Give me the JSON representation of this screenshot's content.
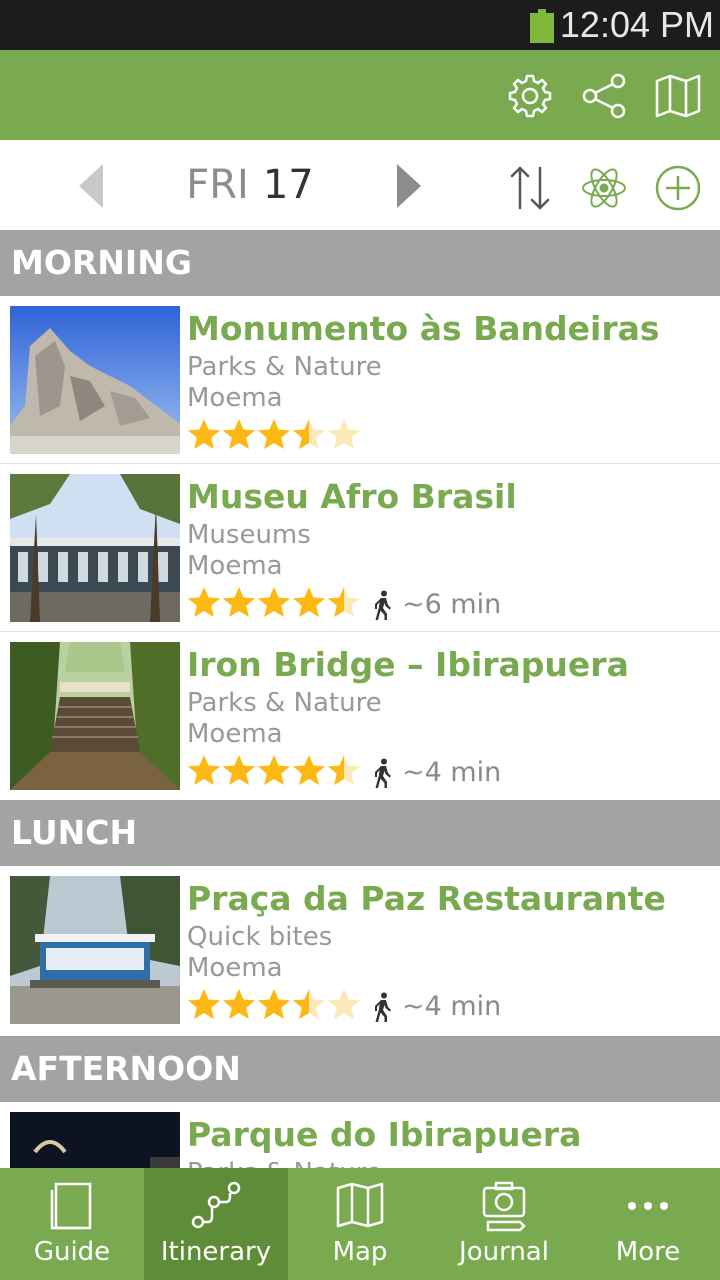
{
  "status_bar": {
    "time": "12:04 PM",
    "battery_icon": "battery-icon"
  },
  "app_bar": {
    "icons": [
      "settings-gear-icon",
      "share-icon",
      "map-icon"
    ]
  },
  "day_selector": {
    "day_of_week": "FRI",
    "day_number": "17"
  },
  "toolbar_icons": [
    "sort-icon",
    "atom-icon",
    "add-circle-icon"
  ],
  "sections": [
    {
      "label": "MORNING"
    },
    {
      "label": "LUNCH"
    },
    {
      "label": "AFTERNOON"
    }
  ],
  "items": [
    {
      "title": "Monumento às Bandeiras",
      "category": "Parks & Nature",
      "area": "Moema",
      "rating": 3.5,
      "walk": ""
    },
    {
      "title": "Museu Afro Brasil",
      "category": "Museums",
      "area": "Moema",
      "rating": 4.5,
      "walk": "~6 min"
    },
    {
      "title": "Iron Bridge – Ibirapuera",
      "category": "Parks & Nature",
      "area": "Moema",
      "rating": 4.5,
      "walk": "~4 min"
    },
    {
      "title": "Praça da Paz Restaurante",
      "category": "Quick bites",
      "area": "Moema",
      "rating": 3.5,
      "walk": "~4 min"
    },
    {
      "title": "Parque do Ibirapuera",
      "category": "Parks & Nature",
      "area": "",
      "rating": null,
      "walk": ""
    }
  ],
  "bottom_nav": {
    "tabs": [
      {
        "label": "Guide",
        "icon": "guide-book-icon"
      },
      {
        "label": "Itinerary",
        "icon": "itinerary-route-icon"
      },
      {
        "label": "Map",
        "icon": "map-icon"
      },
      {
        "label": "Journal",
        "icon": "camera-journal-icon"
      },
      {
        "label": "More",
        "icon": "more-dots-icon"
      }
    ],
    "active_tab": "Itinerary"
  },
  "colors": {
    "accent": "#7aaa50",
    "active_tab": "#5f8c38",
    "section_header": "#a3a3a3",
    "star": "#fdb813",
    "star_empty": "#fde9b8"
  }
}
